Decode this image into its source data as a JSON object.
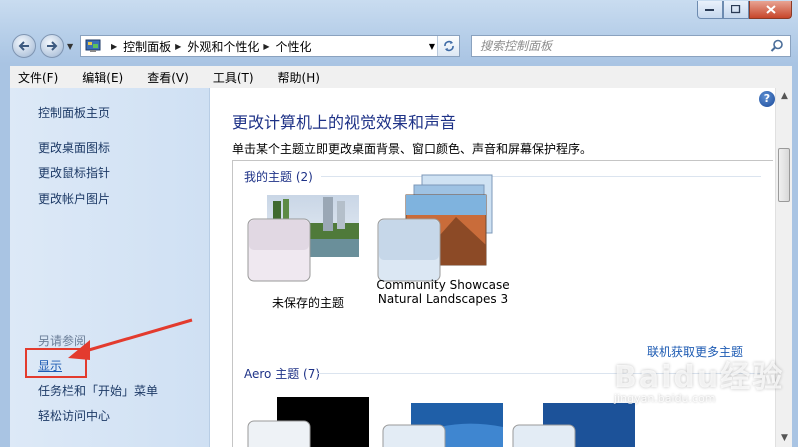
{
  "window": {
    "caption": {
      "minimize": "–",
      "maximize": "□",
      "close": "✕"
    }
  },
  "navigation": {
    "breadcrumbs": [
      "控制面板",
      "外观和个性化",
      "个性化"
    ],
    "search_placeholder": "搜索控制面板"
  },
  "menu": [
    "文件(F)",
    "编辑(E)",
    "查看(V)",
    "工具(T)",
    "帮助(H)"
  ],
  "sidebar": {
    "home": "控制面板主页",
    "links": [
      "更改桌面图标",
      "更改鼠标指针",
      "更改帐户图片"
    ],
    "see_also_label": "另请参阅",
    "see_also": [
      "显示",
      "任务栏和「开始」菜单",
      "轻松访问中心"
    ]
  },
  "main": {
    "heading": "更改计算机上的视觉效果和声音",
    "description": "单击某个主题立即更改桌面背景、窗口颜色、声音和屏幕保护程序。",
    "help_label": "?",
    "my_themes_title": "我的主题 (2)",
    "themes": [
      {
        "name": "未保存的主题"
      },
      {
        "name": "Community Showcase",
        "subtitle": "Natural Landscapes 3"
      }
    ],
    "online_link": "联机获取更多主题",
    "aero_title": "Aero 主题 (7)"
  },
  "watermark": {
    "brand": "Baidu经验",
    "url": "jingyan.baidu.com"
  },
  "colors": {
    "heading": "#1e3287",
    "link": "#1d5bb3",
    "annotation": "#e33b2e"
  }
}
